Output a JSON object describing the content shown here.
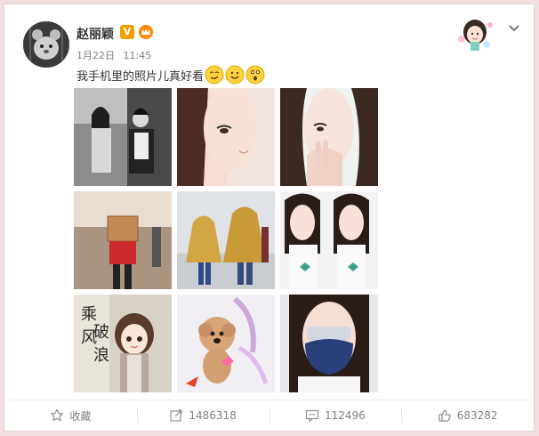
{
  "post": {
    "author": "赵丽颖",
    "verified_mark": "V",
    "date": "1月22日",
    "time": "11:45",
    "text": "我手机里的照片儿真好看"
  },
  "header": {
    "more_icon": "chevron-down-icon"
  },
  "emoji": [
    "smirk-emoji-icon",
    "smile-emoji-icon",
    "thinking-emoji-icon"
  ],
  "photos": [
    {
      "name": "photo-1",
      "description_icon": "couple-bw-photo"
    },
    {
      "name": "photo-2",
      "description_icon": "face-closeup-photo"
    },
    {
      "name": "photo-3",
      "description_icon": "hand-on-face-photo"
    },
    {
      "name": "photo-4",
      "description_icon": "airport-box-photo"
    },
    {
      "name": "photo-5",
      "description_icon": "yellow-cape-photo"
    },
    {
      "name": "photo-6",
      "description_icon": "twin-portrait-photo"
    },
    {
      "name": "photo-7",
      "description_icon": "cartoon-girl-photo"
    },
    {
      "name": "photo-8",
      "description_icon": "poodle-photo"
    },
    {
      "name": "photo-9",
      "description_icon": "mask-photo"
    }
  ],
  "photo_7_text": "乘风破浪",
  "footer": {
    "favorite_label": "收藏",
    "repost_count": "1486318",
    "comment_count": "112496",
    "like_count": "683282"
  },
  "colors": {
    "accent_badge": "#f0a000",
    "background": "#f2dfe0",
    "meta_text": "#808080"
  }
}
